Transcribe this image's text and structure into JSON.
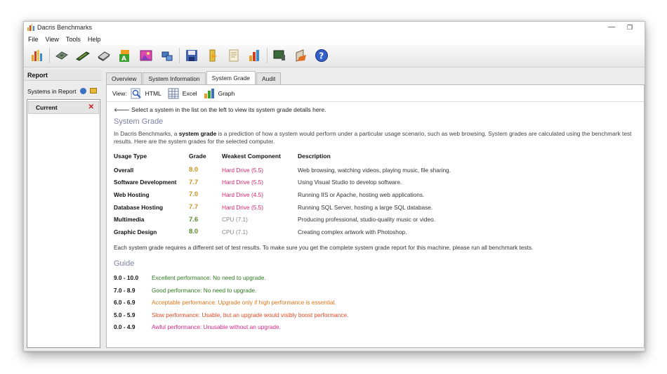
{
  "window": {
    "title": "Dacris Benchmarks",
    "minimize_glyph": "—",
    "restore_glyph": "❐"
  },
  "menu": [
    "File",
    "View",
    "Tools",
    "Help"
  ],
  "toolbar_icons": [
    "benchmark-chart-icon",
    "cpu-icon",
    "memory-icon",
    "disk-icon",
    "graphics-icon",
    "picture-icon",
    "network-icon",
    "save-icon",
    "open-folder-icon",
    "export-icon",
    "graph-report-icon",
    "monitor-icon",
    "settings-icon",
    "help-icon"
  ],
  "left_panel": {
    "header": "Report",
    "systems_label": "Systems in Report",
    "systems": [
      {
        "label": "Current",
        "remove_glyph": "✕"
      }
    ]
  },
  "tabs": [
    {
      "label": "Overview",
      "active": false
    },
    {
      "label": "System Information",
      "active": false
    },
    {
      "label": "System Grade",
      "active": true
    },
    {
      "label": "Audit",
      "active": false
    }
  ],
  "view_bar": {
    "label": "View:",
    "html": "HTML",
    "excel": "Excel",
    "graph": "Graph"
  },
  "content": {
    "back_hint": "🡐 Select a system in the list on the left to view its system grade details here.",
    "section_title": "System Grade",
    "intro_prefix": "In Dacris Benchmarks, a ",
    "intro_bold": "system grade",
    "intro_suffix": " is a prediction of how a system would perform under a particular usage scenario, such as web browsing. System grades are calculated using the benchmark test results. Here are the system grades for the selected computer.",
    "table": {
      "headers": [
        "Usage Type",
        "Grade",
        "Weakest Component",
        "Description"
      ],
      "rows": [
        {
          "usage": "Overall",
          "grade": "8.0",
          "grade_color": "gold",
          "weakest": "Hard Drive (5.5)",
          "weakest_color": "pink",
          "description": "Web browsing, watching videos, playing music, file sharing."
        },
        {
          "usage": "Software Development",
          "grade": "7.7",
          "grade_color": "gold",
          "weakest": "Hard Drive (5.5)",
          "weakest_color": "pink",
          "description": "Using Visual Studio to develop software."
        },
        {
          "usage": "Web Hosting",
          "grade": "7.0",
          "grade_color": "gold",
          "weakest": "Hard Drive (4.5)",
          "weakest_color": "pink",
          "description": "Running IIS or Apache, hosting web applications."
        },
        {
          "usage": "Database Hosting",
          "grade": "7.7",
          "grade_color": "gold",
          "weakest": "Hard Drive (5.5)",
          "weakest_color": "pink",
          "description": "Running SQL Server, hosting a large SQL database."
        },
        {
          "usage": "Multimedia",
          "grade": "7.6",
          "grade_color": "green",
          "weakest": "CPU (7.1)",
          "weakest_color": "grey",
          "description": "Producing professional, studio-quality music or video."
        },
        {
          "usage": "Graphic Design",
          "grade": "8.0",
          "grade_color": "green",
          "weakest": "CPU (7.1)",
          "weakest_color": "grey",
          "description": "Creating complex artwork with Photoshop."
        }
      ]
    },
    "note": "Each system grade requires a different set of test results. To make sure you get the complete system grade report for this machine, please run all benchmark tests.",
    "guide_title": "Guide",
    "guide": [
      {
        "range": "9.0 - 10.0",
        "text": "Excellent performance: No need to upgrade.",
        "color": "g-green"
      },
      {
        "range": "7.0 - 8.9",
        "text": "Good performance: No need to upgrade.",
        "color": "g-green"
      },
      {
        "range": "6.0 - 6.9",
        "text": "Acceptable performance: Upgrade only if high performance is essential.",
        "color": "g-orange"
      },
      {
        "range": "5.0 - 5.9",
        "text": "Slow performance: Usable, but an upgrade would visibly boost performance.",
        "color": "g-red"
      },
      {
        "range": "0.0 - 4.9",
        "text": "Awful performance: Unusable without an upgrade.",
        "color": "g-pink"
      }
    ]
  }
}
